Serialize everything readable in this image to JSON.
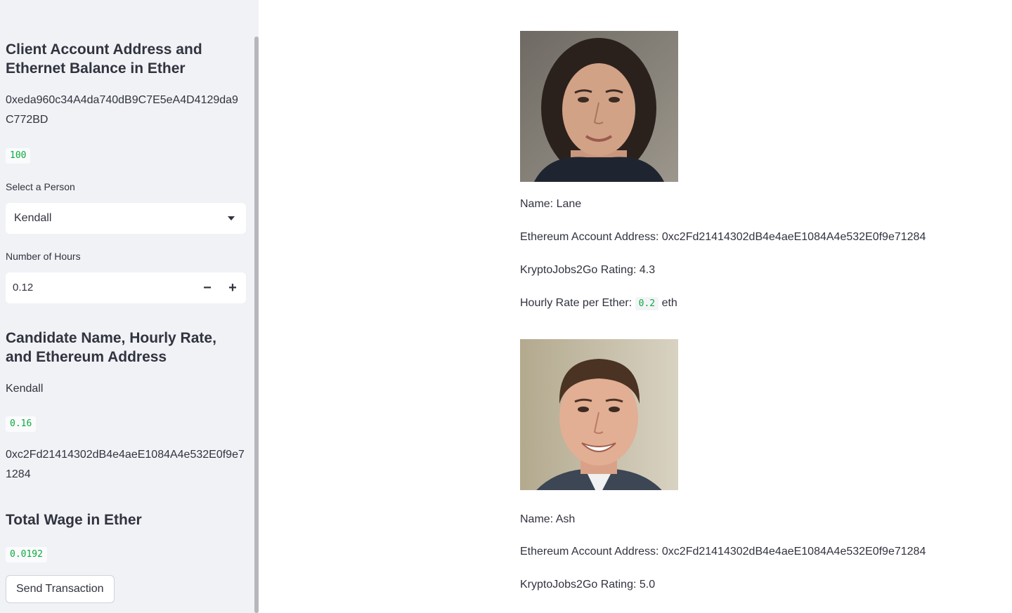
{
  "sidebar": {
    "client_heading": "Client Account Address and Ethernet Balance in Ether",
    "client_address": "0xeda960c34A4da740dB9C7E5eA4D4129da9C772BD",
    "client_balance": "100",
    "select_label": "Select a Person",
    "select_value": "Kendall",
    "hours_label": "Number of Hours",
    "hours_value": "0.12",
    "stepper_minus": "−",
    "stepper_plus": "+",
    "candidate_heading": "Candidate Name, Hourly Rate, and Ethereum Address",
    "candidate_name": "Kendall",
    "candidate_rate": "0.16",
    "candidate_address": "0xc2Fd21414302dB4e4aeE1084A4e532E0f9e71284",
    "wage_heading": "Total Wage in Ether",
    "wage_value": "0.0192",
    "send_button": "Send Transaction"
  },
  "candidates": [
    {
      "name_line": "Name: Lane",
      "address_line": "Ethereum Account Address: 0xc2Fd21414302dB4e4aeE1084A4e532E0f9e71284",
      "rating_line": "KryptoJobs2Go Rating: 4.3",
      "rate_prefix": "Hourly Rate per Ether:",
      "rate_value": "0.2",
      "rate_suffix": "eth"
    },
    {
      "name_line": "Name: Ash",
      "address_line": "Ethereum Account Address: 0xc2Fd21414302dB4e4aeE1084A4e532E0f9e71284",
      "rating_line": "KryptoJobs2Go Rating: 5.0"
    }
  ],
  "colors": {
    "sidebar_bg": "#f0f2f6",
    "code_green": "#09ab3b",
    "text": "#31333f"
  }
}
